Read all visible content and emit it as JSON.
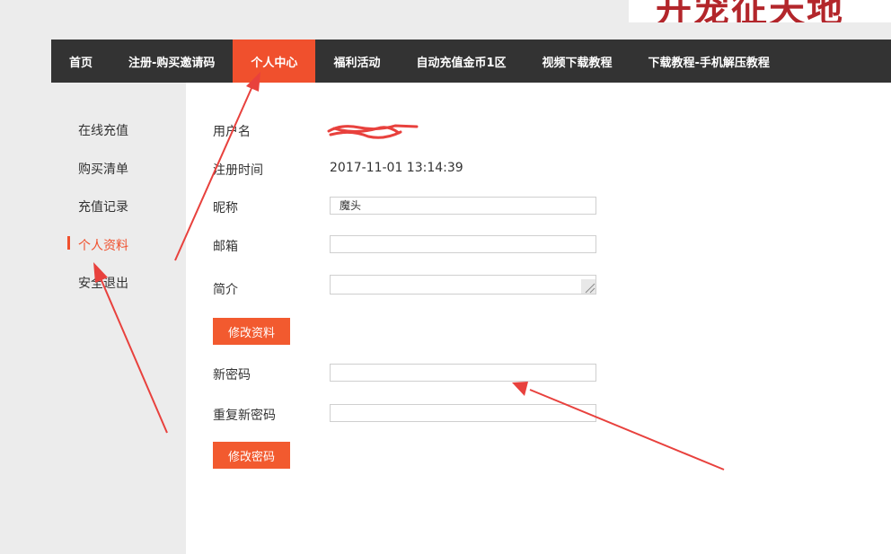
{
  "logo": {
    "text": "开宠征天地"
  },
  "nav": {
    "items": [
      {
        "label": "首页"
      },
      {
        "label": "注册-购买邀请码"
      },
      {
        "label": "个人中心"
      },
      {
        "label": "福利活动"
      },
      {
        "label": "自动充值金币1区"
      },
      {
        "label": "视频下载教程"
      },
      {
        "label": "下载教程-手机解压教程"
      }
    ],
    "active_index": 2
  },
  "sidebar": {
    "items": [
      {
        "label": "在线充值"
      },
      {
        "label": "购买清单"
      },
      {
        "label": "充值记录"
      },
      {
        "label": "个人资料"
      },
      {
        "label": "安全退出"
      }
    ],
    "active_index": 3
  },
  "profile": {
    "username_label": "用户名",
    "username_value": "",
    "reg_time_label": "注册时间",
    "reg_time_value": "2017-11-01 13:14:39",
    "nickname_label": "昵称",
    "nickname_value": "魔头",
    "email_label": "邮箱",
    "email_value": "",
    "bio_label": "简介",
    "bio_value": "",
    "save_button": "修改资料"
  },
  "password": {
    "new_label": "新密码",
    "repeat_label": "重复新密码",
    "save_button": "修改密码"
  },
  "annotation_color": "#e8413d",
  "accent_color": "#f0502d"
}
